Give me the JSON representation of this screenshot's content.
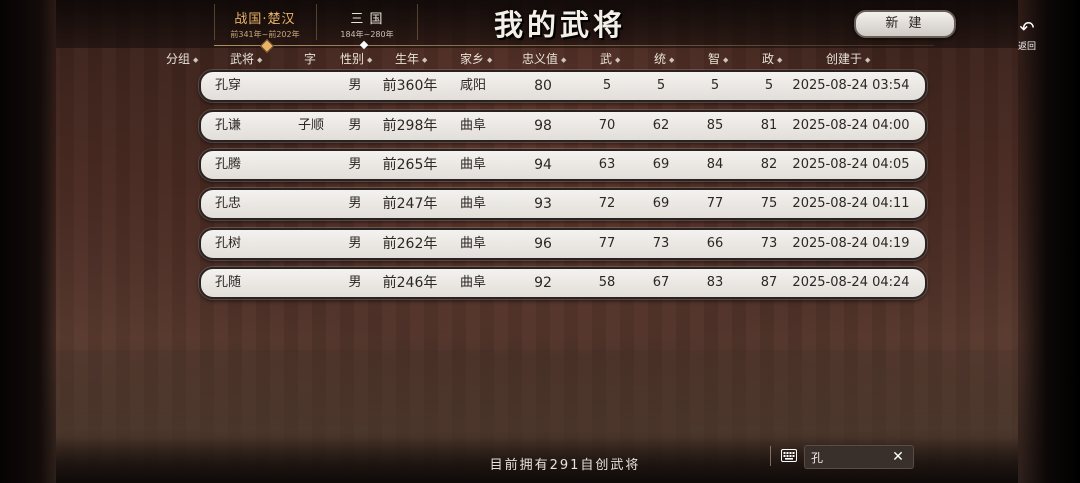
{
  "title": "我的武将",
  "era_tabs": [
    {
      "name": "战国·楚汉",
      "range": "前341年~前202年",
      "active": true
    },
    {
      "name": "三 国",
      "range": "184年~280年",
      "active": false
    }
  ],
  "new_button": "新 建",
  "back_button": {
    "icon": "back-arrow-icon",
    "label": "返回"
  },
  "columns": [
    "分组",
    "武将",
    "字",
    "性别",
    "生年",
    "家乡",
    "忠义值",
    "武",
    "统",
    "智",
    "政",
    "创建于"
  ],
  "rows": [
    {
      "name": "孔穿",
      "courtesy": "",
      "gender": "男",
      "birth": "前360年",
      "hometown": "咸阳",
      "loyalty": "80",
      "war": "5",
      "lead": "5",
      "intel": "5",
      "pol": "5",
      "created": "2025-08-24 03:54"
    },
    {
      "name": "孔谦",
      "courtesy": "子顺",
      "gender": "男",
      "birth": "前298年",
      "hometown": "曲阜",
      "loyalty": "98",
      "war": "70",
      "lead": "62",
      "intel": "85",
      "pol": "81",
      "created": "2025-08-24 04:00"
    },
    {
      "name": "孔腾",
      "courtesy": "",
      "gender": "男",
      "birth": "前265年",
      "hometown": "曲阜",
      "loyalty": "94",
      "war": "63",
      "lead": "69",
      "intel": "84",
      "pol": "82",
      "created": "2025-08-24 04:05"
    },
    {
      "name": "孔忠",
      "courtesy": "",
      "gender": "男",
      "birth": "前247年",
      "hometown": "曲阜",
      "loyalty": "93",
      "war": "72",
      "lead": "69",
      "intel": "77",
      "pol": "75",
      "created": "2025-08-24 04:11"
    },
    {
      "name": "孔树",
      "courtesy": "",
      "gender": "男",
      "birth": "前262年",
      "hometown": "曲阜",
      "loyalty": "96",
      "war": "77",
      "lead": "73",
      "intel": "66",
      "pol": "73",
      "created": "2025-08-24 04:19"
    },
    {
      "name": "孔随",
      "courtesy": "",
      "gender": "男",
      "birth": "前246年",
      "hometown": "曲阜",
      "loyalty": "92",
      "war": "58",
      "lead": "67",
      "intel": "83",
      "pol": "87",
      "created": "2025-08-24 04:24"
    }
  ],
  "status": "目前拥有291自创武将",
  "search": {
    "value": "孔",
    "keyboard_icon": "keyboard-icon",
    "clear_icon": "close-icon"
  },
  "colors": {
    "accent": "#e9b46a",
    "row_bg": "#ece9e5"
  }
}
